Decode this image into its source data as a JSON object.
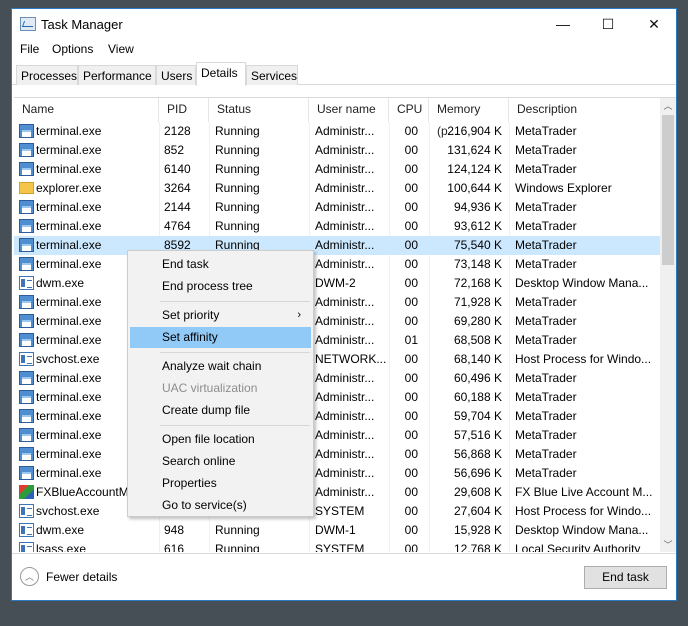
{
  "window": {
    "title": "Task Manager",
    "minimize": "—",
    "maximize": "☐",
    "close": "✕"
  },
  "menu": [
    "File",
    "Options",
    "View"
  ],
  "tabs": [
    "Processes",
    "Performance",
    "Users",
    "Details",
    "Services"
  ],
  "active_tab": "Details",
  "columns": [
    "Name",
    "PID",
    "Status",
    "User name",
    "CPU",
    "Memory (p...",
    "Description"
  ],
  "rows": [
    {
      "icon": "terminal",
      "name": "terminal.exe",
      "pid": "2128",
      "status": "Running",
      "user": "Administr...",
      "cpu": "00",
      "mem": "216,904 K",
      "desc": "MetaTrader"
    },
    {
      "icon": "terminal",
      "name": "terminal.exe",
      "pid": "852",
      "status": "Running",
      "user": "Administr...",
      "cpu": "00",
      "mem": "131,624 K",
      "desc": "MetaTrader"
    },
    {
      "icon": "terminal",
      "name": "terminal.exe",
      "pid": "6140",
      "status": "Running",
      "user": "Administr...",
      "cpu": "00",
      "mem": "124,124 K",
      "desc": "MetaTrader"
    },
    {
      "icon": "folder",
      "name": "explorer.exe",
      "pid": "3264",
      "status": "Running",
      "user": "Administr...",
      "cpu": "00",
      "mem": "100,644 K",
      "desc": "Windows Explorer"
    },
    {
      "icon": "terminal",
      "name": "terminal.exe",
      "pid": "2144",
      "status": "Running",
      "user": "Administr...",
      "cpu": "00",
      "mem": "94,936 K",
      "desc": "MetaTrader"
    },
    {
      "icon": "terminal",
      "name": "terminal.exe",
      "pid": "4764",
      "status": "Running",
      "user": "Administr...",
      "cpu": "00",
      "mem": "93,612 K",
      "desc": "MetaTrader"
    },
    {
      "icon": "terminal",
      "name": "terminal.exe",
      "pid": "8592",
      "status": "Running",
      "user": "Administr...",
      "cpu": "00",
      "mem": "75,540 K",
      "desc": "MetaTrader",
      "selected": true
    },
    {
      "icon": "terminal",
      "name": "terminal.exe",
      "pid": "",
      "status": "",
      "user": "Administr...",
      "cpu": "00",
      "mem": "73,148 K",
      "desc": "MetaTrader"
    },
    {
      "icon": "window",
      "name": "dwm.exe",
      "pid": "",
      "status": "",
      "user": "DWM-2",
      "cpu": "00",
      "mem": "72,168 K",
      "desc": "Desktop Window Mana..."
    },
    {
      "icon": "terminal",
      "name": "terminal.exe",
      "pid": "",
      "status": "",
      "user": "Administr...",
      "cpu": "00",
      "mem": "71,928 K",
      "desc": "MetaTrader"
    },
    {
      "icon": "terminal",
      "name": "terminal.exe",
      "pid": "",
      "status": "",
      "user": "Administr...",
      "cpu": "00",
      "mem": "69,280 K",
      "desc": "MetaTrader"
    },
    {
      "icon": "terminal",
      "name": "terminal.exe",
      "pid": "",
      "status": "",
      "user": "Administr...",
      "cpu": "01",
      "mem": "68,508 K",
      "desc": "MetaTrader"
    },
    {
      "icon": "window",
      "name": "svchost.exe",
      "pid": "",
      "status": "",
      "user": "NETWORK...",
      "cpu": "00",
      "mem": "68,140 K",
      "desc": "Host Process for Windo..."
    },
    {
      "icon": "terminal",
      "name": "terminal.exe",
      "pid": "",
      "status": "",
      "user": "Administr...",
      "cpu": "00",
      "mem": "60,496 K",
      "desc": "MetaTrader"
    },
    {
      "icon": "terminal",
      "name": "terminal.exe",
      "pid": "",
      "status": "",
      "user": "Administr...",
      "cpu": "00",
      "mem": "60,188 K",
      "desc": "MetaTrader"
    },
    {
      "icon": "terminal",
      "name": "terminal.exe",
      "pid": "",
      "status": "",
      "user": "Administr...",
      "cpu": "00",
      "mem": "59,704 K",
      "desc": "MetaTrader"
    },
    {
      "icon": "terminal",
      "name": "terminal.exe",
      "pid": "",
      "status": "",
      "user": "Administr...",
      "cpu": "00",
      "mem": "57,516 K",
      "desc": "MetaTrader"
    },
    {
      "icon": "terminal",
      "name": "terminal.exe",
      "pid": "",
      "status": "",
      "user": "Administr...",
      "cpu": "00",
      "mem": "56,868 K",
      "desc": "MetaTrader"
    },
    {
      "icon": "terminal",
      "name": "terminal.exe",
      "pid": "",
      "status": "",
      "user": "Administr...",
      "cpu": "00",
      "mem": "56,696 K",
      "desc": "MetaTrader"
    },
    {
      "icon": "fx",
      "name": "FXBlueAccountM",
      "pid": "",
      "status": "",
      "user": "Administr...",
      "cpu": "00",
      "mem": "29,608 K",
      "desc": "FX Blue Live Account M..."
    },
    {
      "icon": "window",
      "name": "svchost.exe",
      "pid": "",
      "status": "",
      "user": "SYSTEM",
      "cpu": "00",
      "mem": "27,604 K",
      "desc": "Host Process for Windo..."
    },
    {
      "icon": "window",
      "name": "dwm.exe",
      "pid": "948",
      "status": "Running",
      "user": "DWM-1",
      "cpu": "00",
      "mem": "15,928 K",
      "desc": "Desktop Window Mana..."
    },
    {
      "icon": "window",
      "name": "lsass.exe",
      "pid": "616",
      "status": "Running",
      "user": "SYSTEM",
      "cpu": "00",
      "mem": "12,768 K",
      "desc": "Local Security Authority"
    }
  ],
  "context_menu": [
    {
      "label": "End task"
    },
    {
      "label": "End process tree"
    },
    {
      "sep": true
    },
    {
      "label": "Set priority",
      "submenu": true
    },
    {
      "label": "Set affinity",
      "highlighted": true
    },
    {
      "sep": true
    },
    {
      "label": "Analyze wait chain"
    },
    {
      "label": "UAC virtualization",
      "disabled": true
    },
    {
      "label": "Create dump file"
    },
    {
      "sep": true
    },
    {
      "label": "Open file location"
    },
    {
      "label": "Search online"
    },
    {
      "label": "Properties"
    },
    {
      "label": "Go to service(s)"
    }
  ],
  "footer": {
    "fewer_details": "Fewer details",
    "end_task": "End task"
  },
  "colors": {
    "selection": "#cce8ff",
    "menu_highlight": "#91c9f7",
    "border": "#2b79c2"
  }
}
